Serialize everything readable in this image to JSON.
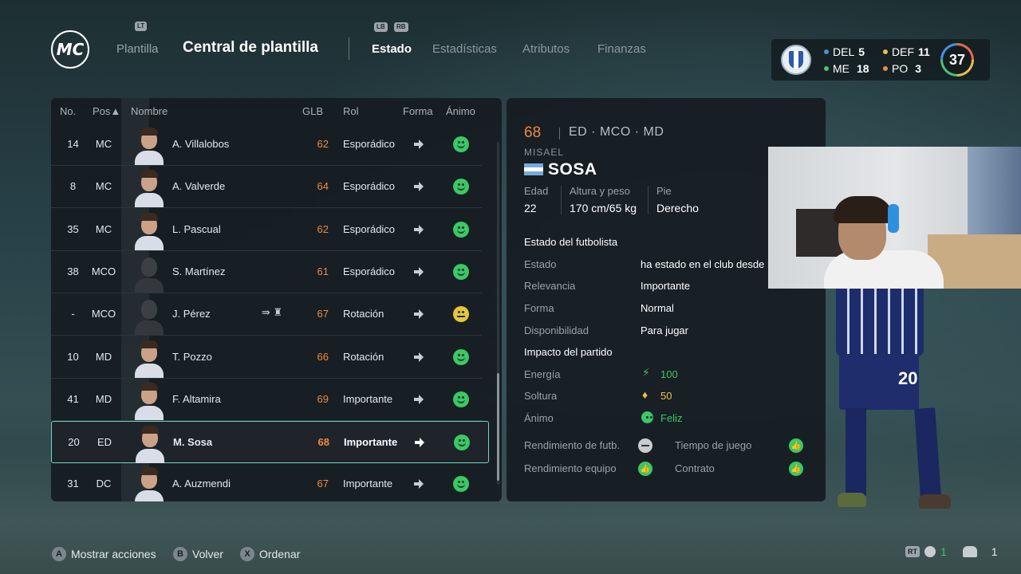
{
  "header": {
    "logo_text": "MC",
    "lt_hint": "LT",
    "lb_hint": "LB",
    "rb_hint": "RB",
    "nav_back": "Plantilla",
    "title": "Central de plantilla",
    "tabs": [
      {
        "label": "Estado",
        "active": true
      },
      {
        "label": "Estadísticas",
        "active": false
      },
      {
        "label": "Atributos",
        "active": false
      },
      {
        "label": "Finanzas",
        "active": false
      }
    ]
  },
  "team": {
    "counts": [
      {
        "label": "DEL",
        "value": "5",
        "color": "#4a8fe0"
      },
      {
        "label": "DEF",
        "value": "11",
        "color": "#e2c24a"
      },
      {
        "label": "ME",
        "value": "18",
        "color": "#4ac07a"
      },
      {
        "label": "PO",
        "value": "3",
        "color": "#e68a4b"
      }
    ],
    "overall": "37"
  },
  "list": {
    "headers": {
      "no": "No.",
      "pos": "Pos▲",
      "name": "Nombre",
      "glb": "GLB",
      "rol": "Rol",
      "forma": "Forma",
      "animo": "Ánimo"
    },
    "rows": [
      {
        "no": "14",
        "pos": "MC",
        "name": "A. Villalobos",
        "glb": "62",
        "rol": "Esporádico",
        "mood": "happy",
        "photo": true
      },
      {
        "no": "8",
        "pos": "MC",
        "name": "A. Valverde",
        "glb": "64",
        "rol": "Esporádico",
        "mood": "happy",
        "photo": true
      },
      {
        "no": "35",
        "pos": "MC",
        "name": "L. Pascual",
        "glb": "62",
        "rol": "Esporádico",
        "mood": "happy",
        "photo": true
      },
      {
        "no": "38",
        "pos": "MCO",
        "name": "S. Martínez",
        "glb": "61",
        "rol": "Esporádico",
        "mood": "happy",
        "photo": false
      },
      {
        "no": "-",
        "pos": "MCO",
        "name": "J. Pérez",
        "glb": "67",
        "rol": "Rotación",
        "mood": "neutral",
        "photo": false,
        "transfer": "⇛ ♜"
      },
      {
        "no": "10",
        "pos": "MD",
        "name": "T. Pozzo",
        "glb": "66",
        "rol": "Rotación",
        "mood": "happy",
        "photo": true
      },
      {
        "no": "41",
        "pos": "MD",
        "name": "F. Altamira",
        "glb": "69",
        "rol": "Importante",
        "mood": "happy",
        "photo": true
      },
      {
        "no": "20",
        "pos": "ED",
        "name": "M. Sosa",
        "glb": "68",
        "rol": "Importante",
        "mood": "happy",
        "photo": true,
        "selected": true
      },
      {
        "no": "31",
        "pos": "DC",
        "name": "A. Auzmendi",
        "glb": "67",
        "rol": "Importante",
        "mood": "happy",
        "photo": true
      }
    ]
  },
  "detail": {
    "overall": "68",
    "positions": "ED · MCO · MD",
    "first_name": "MISAEL",
    "last_name": "SOSA",
    "age_label": "Edad",
    "age": "22",
    "height_label": "Altura y peso",
    "height": "170 cm/65 kg",
    "foot_label": "Pie",
    "foot": "Derecho",
    "status_title": "Estado del futbolista",
    "status": [
      {
        "label": "Estado",
        "value": "ha estado en el club desde"
      },
      {
        "label": "Relevancia",
        "value": "Importante"
      },
      {
        "label": "Forma",
        "value": "Normal"
      },
      {
        "label": "Disponibilidad",
        "value": "Para jugar"
      }
    ],
    "impact_title": "Impacto del partido",
    "impact": [
      {
        "label": "Energía",
        "value": "100",
        "icon": "lightning-icon"
      },
      {
        "label": "Soltura",
        "value": "50",
        "icon": "diamond-icon"
      },
      {
        "label": "Ánimo",
        "value": "Feliz",
        "icon": "smile-icon"
      }
    ],
    "performance": {
      "rend_futb": "Rendimiento de futb.",
      "tiempo": "Tiempo de juego",
      "rend_equipo": "Rendimiento equipo",
      "contrato": "Contrato"
    },
    "kit_number": "20"
  },
  "footer": {
    "actions": [
      {
        "button": "A",
        "label": "Mostrar acciones"
      },
      {
        "button": "B",
        "label": "Volver"
      },
      {
        "button": "X",
        "label": "Ordenar"
      }
    ],
    "rt_hint": "RT",
    "voice_count": "1",
    "users_count": "1"
  }
}
